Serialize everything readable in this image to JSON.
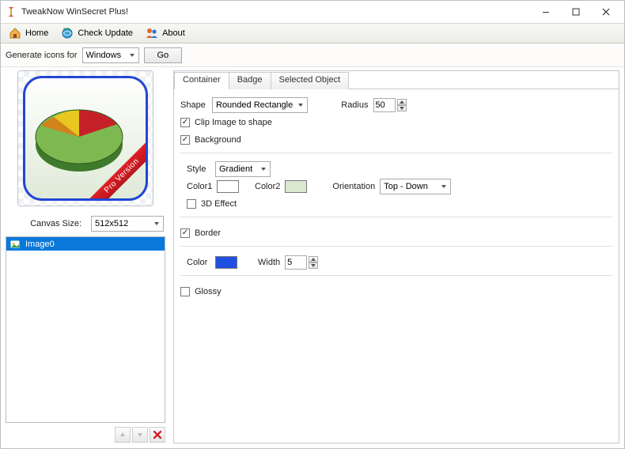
{
  "app": {
    "title": "TweakNow WinSecret Plus!"
  },
  "toolbar": {
    "home": "Home",
    "check_update": "Check Update",
    "about": "About"
  },
  "generate": {
    "label": "Generate icons for",
    "target": "Windows",
    "go": "Go"
  },
  "preview": {
    "ribbon": "Pro Version"
  },
  "canvas": {
    "label": "Canvas Size:",
    "value": "512x512"
  },
  "layers": {
    "items": [
      "Image0"
    ]
  },
  "tabs": {
    "container": "Container",
    "badge": "Badge",
    "selected": "Selected Object"
  },
  "container": {
    "shape_label": "Shape",
    "shape_value": "Rounded Rectangle",
    "radius_label": "Radius",
    "radius_value": "50",
    "clip_label": "Clip Image to shape",
    "clip_checked": true,
    "background_label": "Background",
    "background_checked": true,
    "style_label": "Style",
    "style_value": "Gradient",
    "color1_label": "Color1",
    "color1_value": "#ffffff",
    "color2_label": "Color2",
    "color2_value": "#d9e8cf",
    "orientation_label": "Orientation",
    "orientation_value": "Top - Down",
    "effect3d_label": "3D Effect",
    "effect3d_checked": false,
    "border_label": "Border",
    "border_checked": true,
    "border_color_label": "Color",
    "border_color_value": "#1f4fe0",
    "border_width_label": "Width",
    "border_width_value": "5",
    "glossy_label": "Glossy",
    "glossy_checked": false
  }
}
